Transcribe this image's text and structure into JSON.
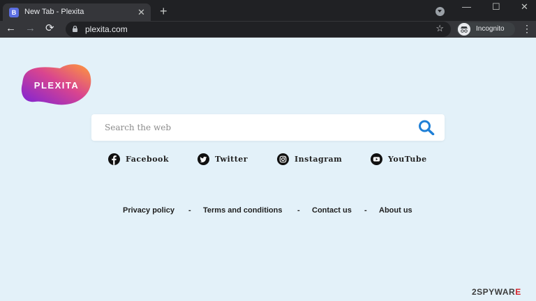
{
  "browser": {
    "tab": {
      "favicon_letter": "B",
      "title": "New Tab - Plexita",
      "close": "✕"
    },
    "new_tab": "+",
    "window": {
      "minimize": "—",
      "maximize": "☐",
      "close": "✕"
    },
    "nav": {
      "back": "←",
      "forward": "→",
      "reload": "⟳"
    },
    "address": "plexita.com",
    "bookmark": "☆",
    "profile": "Incognito",
    "menu": "⋮"
  },
  "page": {
    "logo_text": "PLEXITA",
    "search": {
      "placeholder": "Search the web",
      "accent_color": "#1f7fd6"
    },
    "social": [
      {
        "label": "Facebook",
        "icon": "facebook-icon"
      },
      {
        "label": "Twitter",
        "icon": "twitter-icon"
      },
      {
        "label": "Instagram",
        "icon": "instagram-icon"
      },
      {
        "label": "YouTube",
        "icon": "youtube-icon"
      }
    ],
    "footer": {
      "privacy": "Privacy policy",
      "terms": "Terms and conditions",
      "contact": "Contact us",
      "about": "About us",
      "separator": "-"
    }
  },
  "watermark": {
    "brand": "2SPYWAR",
    "suffix": "E"
  },
  "colors": {
    "page_bg": "#e3f1f9",
    "logo_gradient": [
      "#8a2be2",
      "#ff8a3d"
    ]
  }
}
